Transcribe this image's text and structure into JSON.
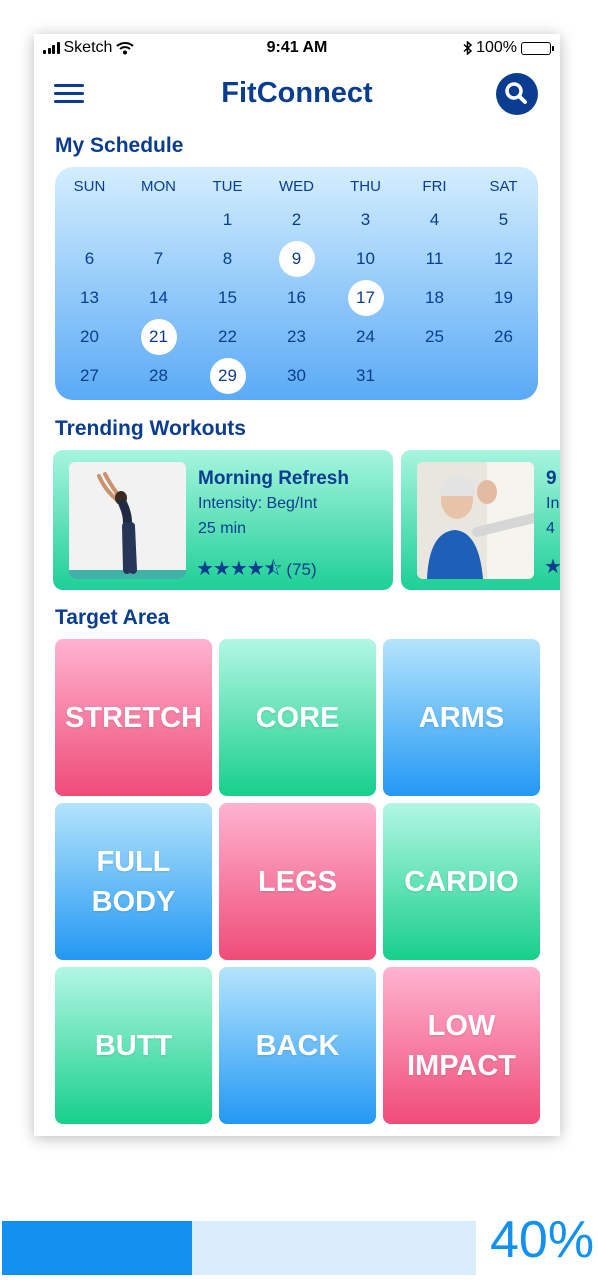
{
  "status_bar": {
    "carrier": "Sketch",
    "time": "9:41 AM",
    "battery": "100%"
  },
  "header": {
    "title": "FitConnect",
    "menu_icon": "hamburger-menu-icon",
    "search_icon": "search-icon"
  },
  "schedule": {
    "heading": "My Schedule",
    "weekdays": [
      "SUN",
      "MON",
      "TUE",
      "WED",
      "THU",
      "FRI",
      "SAT"
    ],
    "weeks": [
      [
        "",
        "",
        "1",
        "2",
        "3",
        "4",
        "5"
      ],
      [
        "6",
        "7",
        "8",
        "9",
        "10",
        "11",
        "12"
      ],
      [
        "13",
        "14",
        "15",
        "16",
        "17",
        "18",
        "19"
      ],
      [
        "20",
        "21",
        "22",
        "23",
        "24",
        "25",
        "26"
      ],
      [
        "27",
        "28",
        "29",
        "30",
        "31",
        "",
        ""
      ]
    ],
    "highlighted": [
      "9",
      "17",
      "21",
      "29"
    ]
  },
  "trending": {
    "heading": "Trending Workouts",
    "cards": [
      {
        "name": "Morning Refresh",
        "intensity": "Intensity: Beg/Int",
        "duration": "25 min",
        "rating": 4.5,
        "stars": "★★★★⯪",
        "reviews": "(75)"
      },
      {
        "name": "9",
        "intensity": "In",
        "duration": "4",
        "rating": null,
        "stars": "★",
        "reviews": ""
      }
    ]
  },
  "target_area": {
    "heading": "Target Area",
    "tiles": [
      {
        "label": "STRETCH",
        "color": "pink"
      },
      {
        "label": "CORE",
        "color": "green"
      },
      {
        "label": "ARMS",
        "color": "blue"
      },
      {
        "label": "FULL\nBODY",
        "color": "blue"
      },
      {
        "label": "LEGS",
        "color": "pink"
      },
      {
        "label": "CARDIO",
        "color": "green"
      },
      {
        "label": "BUTT",
        "color": "green"
      },
      {
        "label": "BACK",
        "color": "blue"
      },
      {
        "label": "LOW\nIMPACT",
        "color": "pink"
      }
    ]
  },
  "progress": {
    "label": "40%",
    "value": 0.4
  }
}
